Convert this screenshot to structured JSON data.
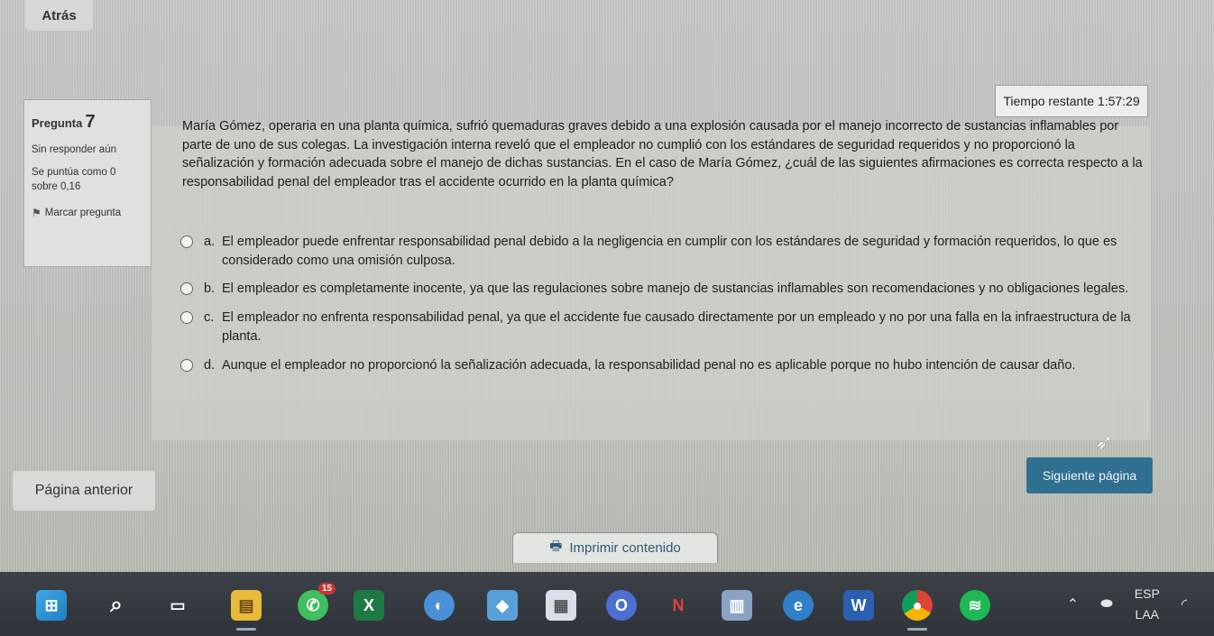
{
  "nav": {
    "back_label": "Atrás"
  },
  "timer": {
    "label": "Tiempo restante 1:57:29"
  },
  "question_info": {
    "title": "Pregunta",
    "number": "7",
    "status": "Sin responder aún",
    "score": "Se puntúa como 0 sobre 0,16",
    "flag_label": "Marcar pregunta"
  },
  "question": {
    "text": "María Gómez, operaria en una planta química, sufrió quemaduras graves debido a una explosión causada por el manejo incorrecto de sustancias inflamables por parte de uno de sus colegas. La investigación interna reveló que el empleador no cumplió con los estándares de seguridad requeridos y no proporcionó la señalización y formación adecuada sobre el manejo de dichas sustancias. En el caso de María Gómez, ¿cuál de las siguientes afirmaciones es correcta respecto a la responsabilidad penal del empleador tras el accidente ocurrido en la planta química?",
    "options": [
      {
        "letter": "a.",
        "text": "El empleador puede enfrentar responsabilidad penal debido a la negligencia en cumplir con los estándares de seguridad y formación requeridos, lo que es considerado como una omisión culposa."
      },
      {
        "letter": "b.",
        "text": "El empleador es completamente inocente, ya que las regulaciones sobre manejo de sustancias inflamables son recomendaciones y no obligaciones legales."
      },
      {
        "letter": "c.",
        "text": "El empleador no enfrenta responsabilidad penal, ya que el accidente fue causado directamente por un empleado y no por una falla en la infraestructura de la planta."
      },
      {
        "letter": "d.",
        "text": "Aunque el empleador no proporcionó la señalización adecuada, la responsabilidad penal no es aplicable porque no hubo intención de causar daño."
      }
    ]
  },
  "footer": {
    "prev_label": "Página anterior",
    "next_label": "Siguiente página",
    "print_label": "Imprimir contenido"
  },
  "taskbar": {
    "chat_badge": "15",
    "lang_top": "ESP",
    "lang_bottom": "LAA"
  }
}
